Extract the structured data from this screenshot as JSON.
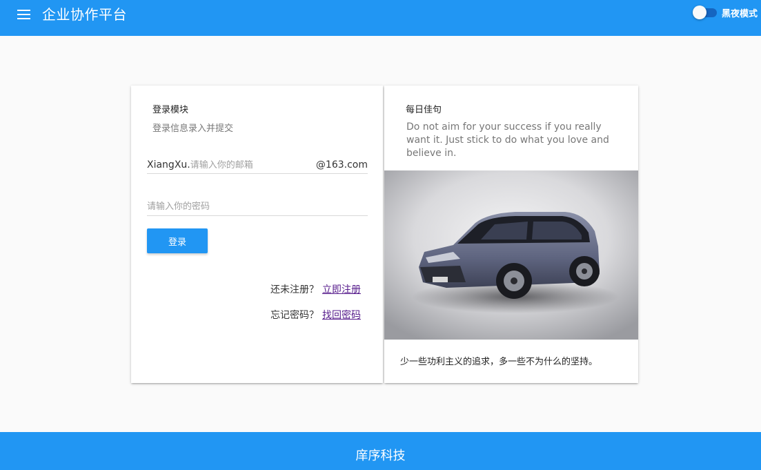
{
  "header": {
    "title": "企业协作平台",
    "menu_icon": "hamburger-menu-icon",
    "dark_mode_label": "黑夜模式",
    "dark_mode_on": false
  },
  "login_card": {
    "title": "登录模块",
    "subtitle": "登录信息录入并提交",
    "email": {
      "prefix": "XiangXu.",
      "placeholder": "请输入你的邮箱",
      "suffix": "@163.com",
      "value": ""
    },
    "password": {
      "placeholder": "请输入你的密码",
      "value": ""
    },
    "login_button": "登录",
    "register_prompt": "还未注册？",
    "register_link": "立即注册",
    "forgot_prompt": "忘记密码？",
    "forgot_link": "找回密码"
  },
  "quote_card": {
    "title": "每日佳句",
    "quote": "Do not aim for your success if you really want it. Just stick to do what you love and believe in.",
    "image": "suv-car-photo",
    "caption": "少一些功利主义的追求，多一些不为什么的坚持。"
  },
  "footer": {
    "text": "庠序科技"
  },
  "colors": {
    "primary": "#2196f3",
    "background": "#fafafa",
    "link": "#551a8b"
  }
}
